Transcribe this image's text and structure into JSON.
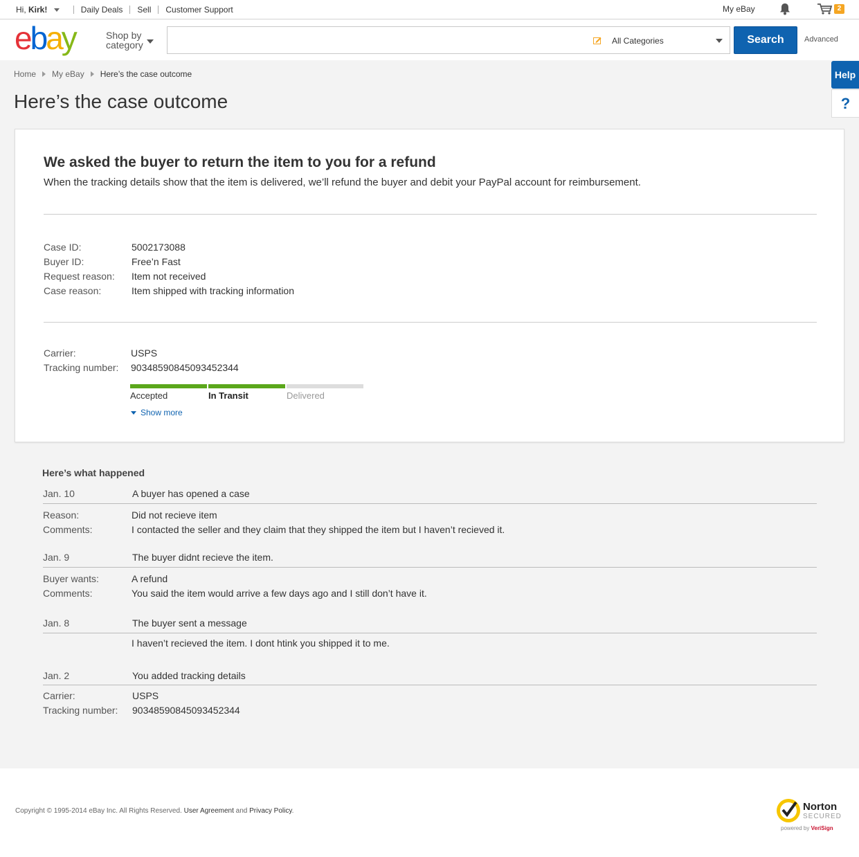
{
  "topbar": {
    "greeting_prefix": "Hi, ",
    "user_name": "Kirk!",
    "links": [
      "Daily Deals",
      "Sell",
      "Customer Support"
    ],
    "my_ebay": "My eBay",
    "cart_count": "2"
  },
  "header": {
    "shop_by_line1": "Shop by",
    "shop_by_line2": "category",
    "search_value": "",
    "category_selected": "All Categories",
    "search_button": "Search",
    "advanced_link": "Advanced"
  },
  "help": {
    "label": "Help",
    "question": "?"
  },
  "breadcrumb": [
    "Home",
    "My eBay",
    "Here’s the case outcome"
  ],
  "page_title": "Here’s the case outcome",
  "outcome": {
    "heading": "We asked the buyer to return the item to you for a refund",
    "description": "When the tracking details show that the item is delivered, we’ll refund the buyer and debit your PayPal account for reimbursement."
  },
  "case_details": [
    {
      "label": "Case ID:",
      "value": "5002173088"
    },
    {
      "label": "Buyer ID:",
      "value": "Free’n Fast"
    },
    {
      "label": "Request reason:",
      "value": "Item not received"
    },
    {
      "label": "Case reason:",
      "value": "Item shipped with tracking information"
    }
  ],
  "shipping": {
    "carrier_label": "Carrier:",
    "carrier": "USPS",
    "tracking_label": "Tracking number:",
    "tracking_number": "9034859084509345234​4",
    "steps": [
      {
        "label": "Accepted",
        "state": "complete"
      },
      {
        "label": "In Transit",
        "state": "current"
      },
      {
        "label": "Delivered",
        "state": "pending"
      }
    ],
    "show_more": "Show more"
  },
  "colors": {
    "accent": "#0f63b0",
    "progress_complete": "#5ba71b",
    "progress_pending": "#dddddd"
  },
  "history": {
    "title": "Here’s what happened",
    "events": [
      {
        "date": "Jan. 10",
        "title": "A buyer has opened a case",
        "details": [
          {
            "label": "Reason:",
            "value": "Did not recieve item"
          },
          {
            "label": "Comments:",
            "value": "I contacted the seller and they claim that they shipped the item but I haven’t recieved it."
          }
        ]
      },
      {
        "date": "Jan. 9",
        "title": "The buyer didnt recieve the item.",
        "details": [
          {
            "label": "Buyer wants:",
            "value": "A refund"
          },
          {
            "label": "Comments:",
            "value": "You said the item would arrive a few days ago and I still don’t have it."
          }
        ]
      },
      {
        "date": "Jan. 8",
        "title": "The buyer sent a message",
        "details": [
          {
            "label": "",
            "value": "I haven’t recieved the item. I dont htink you shipped it to me."
          }
        ]
      },
      {
        "date": "Jan. 2",
        "title": "You added tracking details",
        "details": [
          {
            "label": "Carrier:",
            "value": "USPS"
          },
          {
            "label": "Tracking number:",
            "value": "9034859084509345234​4"
          }
        ]
      }
    ]
  },
  "footer": {
    "copyright": "Copyright © 1995-2014 eBay Inc. All Rights Reserved. ",
    "user_agreement": "User Agreement",
    "and": " and ",
    "privacy_policy": "Privacy Policy",
    "period": ".",
    "norton_brand": "Norton",
    "norton_secured": "SECURED",
    "norton_powered": "powered by ",
    "norton_verisign": "VeriSign"
  }
}
